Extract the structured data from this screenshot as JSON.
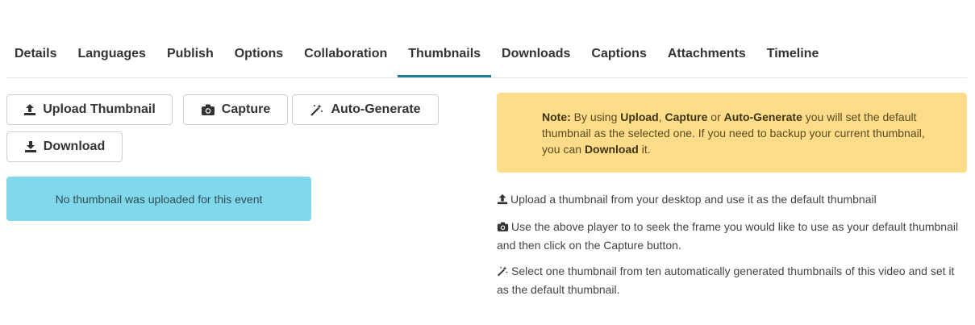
{
  "tabs": [
    {
      "label": "Details"
    },
    {
      "label": "Languages"
    },
    {
      "label": "Publish"
    },
    {
      "label": "Options"
    },
    {
      "label": "Collaboration"
    },
    {
      "label": "Thumbnails",
      "active": true
    },
    {
      "label": "Downloads"
    },
    {
      "label": "Captions"
    },
    {
      "label": "Attachments"
    },
    {
      "label": "Timeline"
    }
  ],
  "toolbar": {
    "upload_label": "Upload Thumbnail",
    "capture_label": "Capture",
    "autogen_label": "Auto-Generate",
    "download_label": "Download"
  },
  "status": {
    "message": "No thumbnail was uploaded for this event"
  },
  "note": {
    "prefix": "Note:",
    "t1": " By using ",
    "upload": "Upload",
    "t2": ", ",
    "capture": "Capture",
    "t3": " or ",
    "autogen": "Auto-Generate",
    "t4": " you will set the default thumbnail as the selected one. If you need to backup your current thumbnail, you can ",
    "download": "Download",
    "t5": " it."
  },
  "help": {
    "upload": "Upload a thumbnail from your desktop and use it as the default thumbnail",
    "capture": "Use the above player to to seek the frame you would like to use as your default thumbnail and then click on the Capture button.",
    "autogen": "Select one thumbnail from ten automatically generated thumbnails of this video and set it as the default thumbnail."
  },
  "colors": {
    "tab_active_underline": "#1a7f97",
    "info_bg": "#80d8ea",
    "note_bg": "#fddd8a"
  },
  "icons": {
    "upload": "upload-icon",
    "capture": "camera-icon",
    "autogen": "magic-wand-icon",
    "download": "download-icon"
  }
}
